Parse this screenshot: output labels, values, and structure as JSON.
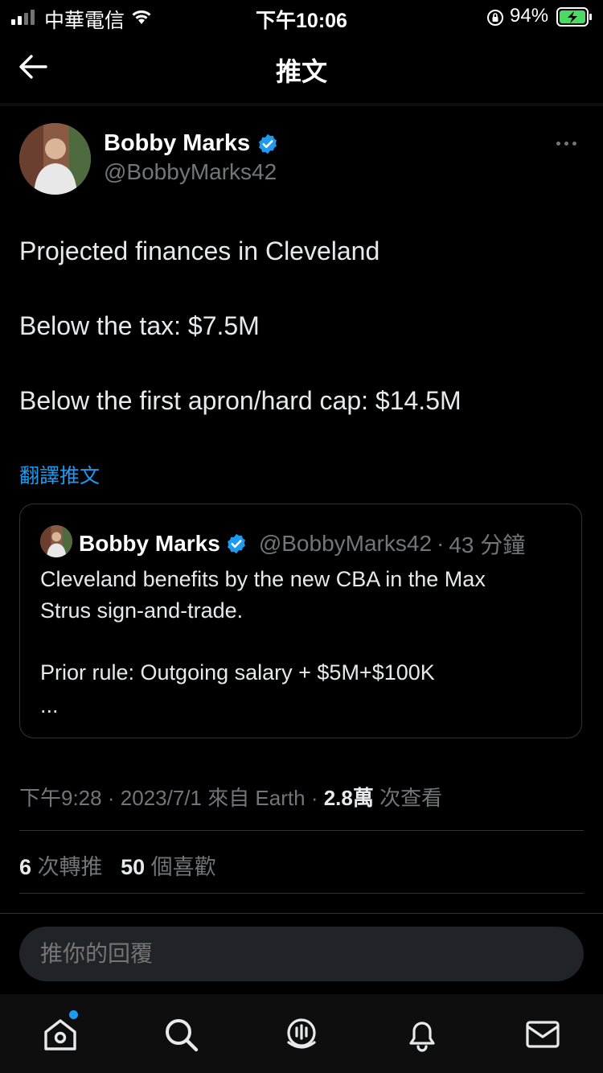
{
  "status_bar": {
    "carrier": "中華電信",
    "time": "下午10:06",
    "battery": "94%"
  },
  "nav": {
    "title": "推文"
  },
  "tweet": {
    "author_name": "Bobby Marks",
    "author_handle": "@BobbyMarks42",
    "lines": [
      "Projected finances in Cleveland",
      "Below the tax: $7.5M",
      "Below the first apron/hard cap: $14.5M"
    ],
    "translate_label": "翻譯推文"
  },
  "quote": {
    "name": "Bobby Marks",
    "handle": "@BobbyMarks42",
    "sep": "·",
    "age": "43 分鐘",
    "lines": [
      "Cleveland benefits by the new CBA in the Max",
      "Strus sign-and-trade.",
      "Prior rule: Outgoing salary + $5M+$100K",
      "..."
    ]
  },
  "meta": {
    "time": "下午9:28",
    "sep1": "·",
    "date": "2023/7/1",
    "source": "來自 Earth",
    "sep2": "·",
    "views_count": "2.8萬",
    "views_label": "次查看"
  },
  "stats": {
    "retweets_count": "6",
    "retweets_label": "次轉推",
    "likes_count": "50",
    "likes_label": "個喜歡"
  },
  "reply": {
    "placeholder": "推你的回覆"
  },
  "icons": {
    "back": "arrow-left-icon",
    "verified": "verified-badge-icon",
    "more": "more-horizontal-icon",
    "tabs": [
      "home-icon",
      "search-icon",
      "spaces-icon",
      "notifications-icon",
      "messages-icon"
    ]
  },
  "colors": {
    "accent": "#1d9bf0",
    "background": "#000000",
    "muted": "#71767b"
  }
}
